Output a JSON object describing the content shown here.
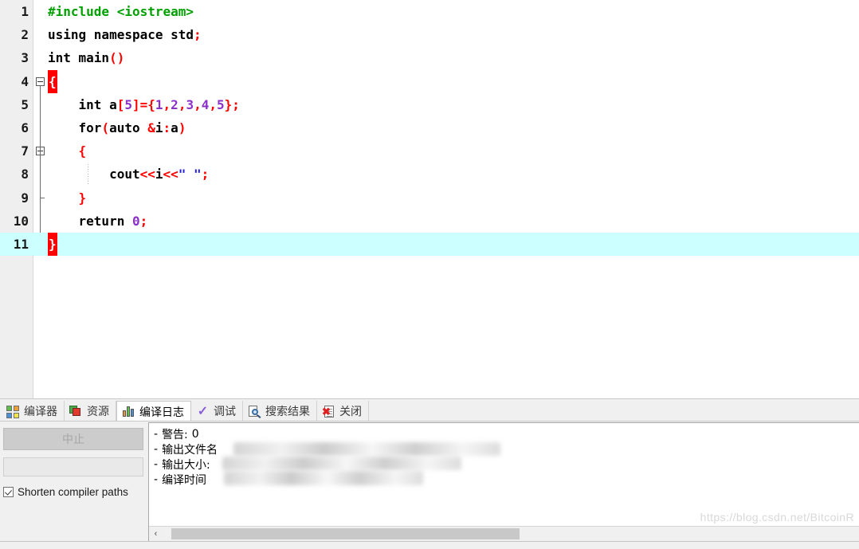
{
  "editor": {
    "lines": [
      {
        "no": "1",
        "indent": 0,
        "tokens": [
          {
            "t": "#include <iostream>",
            "c": "t-pre"
          }
        ]
      },
      {
        "no": "2",
        "indent": 0,
        "tokens": [
          {
            "t": "using namespace std",
            "c": "t-kw"
          },
          {
            "t": ";",
            "c": "t-op"
          }
        ]
      },
      {
        "no": "3",
        "indent": 0,
        "tokens": [
          {
            "t": "int main",
            "c": "t-kw"
          },
          {
            "t": "()",
            "c": "t-op"
          }
        ]
      },
      {
        "no": "4",
        "indent": 0,
        "tokens": [
          {
            "t": "{",
            "c": "t-brace-hl"
          }
        ]
      },
      {
        "no": "5",
        "indent": 0,
        "tokens": [
          {
            "t": "    int a",
            "c": "t-kw"
          },
          {
            "t": "[",
            "c": "t-op"
          },
          {
            "t": "5",
            "c": "t-num"
          },
          {
            "t": "]={",
            "c": "t-op"
          },
          {
            "t": "1",
            "c": "t-num"
          },
          {
            "t": ",",
            "c": "t-op"
          },
          {
            "t": "2",
            "c": "t-num"
          },
          {
            "t": ",",
            "c": "t-op"
          },
          {
            "t": "3",
            "c": "t-num"
          },
          {
            "t": ",",
            "c": "t-op"
          },
          {
            "t": "4",
            "c": "t-num"
          },
          {
            "t": ",",
            "c": "t-op"
          },
          {
            "t": "5",
            "c": "t-num"
          },
          {
            "t": "};",
            "c": "t-op"
          }
        ]
      },
      {
        "no": "6",
        "indent": 0,
        "tokens": [
          {
            "t": "    for",
            "c": "t-kw"
          },
          {
            "t": "(",
            "c": "t-op"
          },
          {
            "t": "auto ",
            "c": "t-kw"
          },
          {
            "t": "&",
            "c": "t-op"
          },
          {
            "t": "i",
            "c": "t-id"
          },
          {
            "t": ":",
            "c": "t-op"
          },
          {
            "t": "a",
            "c": "t-id"
          },
          {
            "t": ")",
            "c": "t-op"
          }
        ]
      },
      {
        "no": "7",
        "indent": 0,
        "tokens": [
          {
            "t": "    ",
            "c": "t-kw"
          },
          {
            "t": "{",
            "c": "t-op"
          }
        ]
      },
      {
        "no": "8",
        "indent": 0,
        "tokens": [
          {
            "t": "        cout",
            "c": "t-id"
          },
          {
            "t": "<<",
            "c": "t-op"
          },
          {
            "t": "i",
            "c": "t-id"
          },
          {
            "t": "<<",
            "c": "t-op"
          },
          {
            "t": "\" \"",
            "c": "t-str"
          },
          {
            "t": ";",
            "c": "t-op"
          }
        ]
      },
      {
        "no": "9",
        "indent": 0,
        "tokens": [
          {
            "t": "    ",
            "c": "t-kw"
          },
          {
            "t": "}",
            "c": "t-op"
          }
        ]
      },
      {
        "no": "10",
        "indent": 0,
        "tokens": [
          {
            "t": "    return ",
            "c": "t-kw"
          },
          {
            "t": "0",
            "c": "t-num"
          },
          {
            "t": ";",
            "c": "t-op"
          }
        ]
      },
      {
        "no": "11",
        "indent": 0,
        "highlight": true,
        "tokens": [
          {
            "t": "}",
            "c": "t-brace-hl"
          }
        ]
      }
    ],
    "folds": [
      {
        "line": 4,
        "type": "box-open"
      },
      {
        "line": 7,
        "type": "box-open"
      },
      {
        "line": 9,
        "type": "tick"
      },
      {
        "line": 11,
        "type": "corner"
      }
    ]
  },
  "panel": {
    "tabs": [
      {
        "label": "编译器",
        "icon": "grid-icon",
        "active": false
      },
      {
        "label": "资源",
        "icon": "layers-icon",
        "active": false
      },
      {
        "label": "编译日志",
        "icon": "bar-chart-icon",
        "active": true
      },
      {
        "label": "调试",
        "icon": "check-icon",
        "active": false
      },
      {
        "label": "搜索结果",
        "icon": "search-icon",
        "active": false
      },
      {
        "label": "关闭",
        "icon": "close-doc-icon",
        "active": false
      }
    ],
    "abort_button": "中止",
    "progress_value": "",
    "shorten_paths": {
      "label": "Shorten compiler paths",
      "checked": true
    },
    "log": {
      "dash": "-",
      "entries": [
        {
          "label": "警告:",
          "value": "0",
          "redacted": false
        },
        {
          "label": "输出文件名",
          "value": "",
          "redacted": true
        },
        {
          "label": "输出大小:",
          "value": "",
          "redacted": true
        },
        {
          "label": "编译时间",
          "value": "",
          "redacted": true
        }
      ]
    },
    "scrollbar": {
      "left_arrow": "‹"
    }
  },
  "watermark": "https://blog.csdn.net/BitcoinR",
  "statusbar": {
    "cells": [
      "",
      "",
      "",
      "",
      "",
      "",
      ""
    ]
  },
  "colors": {
    "preprocessor": "#00a000",
    "operator": "#ff0000",
    "number": "#8b2fc9",
    "string": "#2222dd",
    "brace_match_bg": "#ff0000",
    "current_line_bg": "#ccffff",
    "gutter_bg": "#efefef",
    "panel_bg": "#f0f0f0"
  }
}
